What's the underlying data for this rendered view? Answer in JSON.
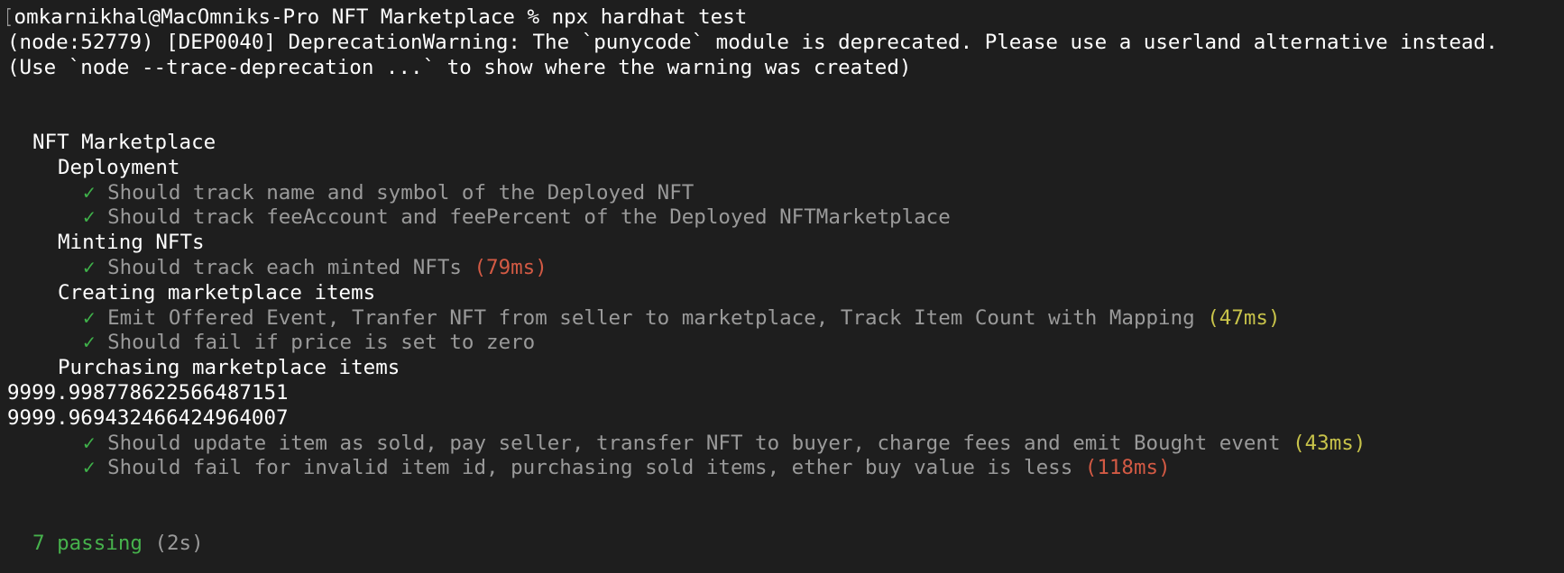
{
  "prompt": {
    "cursor_mark": "[",
    "text": "omkarnikhal@MacOmniks-Pro NFT Marketplace % npx hardhat test"
  },
  "warnings": [
    "(node:52779) [DEP0040] DeprecationWarning: The `punycode` module is deprecated. Please use a userland alternative instead.",
    "(Use `node --trace-deprecation ...` to show where the warning was created)"
  ],
  "suite": {
    "title": "NFT Marketplace",
    "check_glyph": "✓",
    "groups": [
      {
        "title": "Deployment",
        "tests": [
          {
            "text": "Should track name and symbol of the Deployed NFT",
            "time": ""
          },
          {
            "text": "Should track feeAccount and feePercent of the Deployed NFTMarketplace",
            "time": ""
          }
        ]
      },
      {
        "title": "Minting NFTs",
        "tests": [
          {
            "text": "Should track each minted NFTs",
            "time": "(79ms)",
            "time_color": "#d35a44"
          }
        ]
      },
      {
        "title": "Creating marketplace items",
        "tests": [
          {
            "text": "Emit Offered Event, Tranfer NFT from seller to marketplace, Track Item Count with Mapping",
            "time": "(47ms)",
            "time_color": "#c8c34a"
          },
          {
            "text": "Should fail if price is set to zero",
            "time": ""
          }
        ]
      },
      {
        "title": "Purchasing marketplace items",
        "logs": [
          "9999.998778622566487151",
          "9999.969432466424964007"
        ],
        "tests": [
          {
            "text": "Should update item as sold, pay seller, transfer NFT to buyer, charge fees and emit Bought event",
            "time": "(43ms)",
            "time_color": "#c8c34a"
          },
          {
            "text": "Should fail for invalid item id, purchasing sold items, ether buy value is less",
            "time": "(118ms)",
            "time_color": "#d35a44"
          }
        ]
      }
    ]
  },
  "summary": {
    "passing": "7 passing",
    "duration": "(2s)"
  },
  "colors": {
    "background": "#1e1e1e",
    "text": "#ffffff",
    "test_text": "#9a9a9a",
    "check": "#3fb24a",
    "slow": "#d35a44",
    "medium": "#c8c34a",
    "passing": "#46b24c"
  }
}
